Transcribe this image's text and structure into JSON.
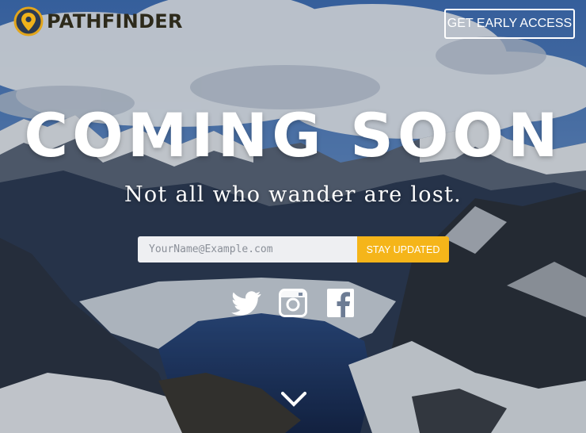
{
  "brand": {
    "name": "PATHFINDER"
  },
  "header": {
    "cta_label": "GET EARLY ACCESS"
  },
  "hero": {
    "title": "COMING SOON",
    "subtitle": "Not all who wander are lost."
  },
  "signup": {
    "email_placeholder": "YourName@Example.com",
    "email_value": "",
    "submit_label": "STAY UPDATED"
  },
  "social": {
    "icons": [
      "twitter-icon",
      "instagram-icon",
      "facebook-icon"
    ]
  },
  "colors": {
    "accent": "#f5b51a",
    "logo_text": "#2d2a1b",
    "input_bg": "#eeeff2",
    "sky": "#4a7bc0"
  }
}
